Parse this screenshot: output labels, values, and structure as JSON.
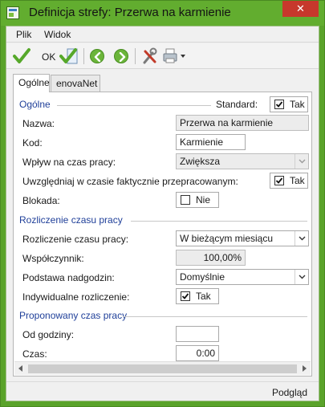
{
  "window": {
    "title": "Definicja strefy: Przerwa na karmienie",
    "close_glyph": "✕"
  },
  "menu": {
    "items": [
      {
        "label": "Plik"
      },
      {
        "label": "Widok"
      }
    ]
  },
  "toolbar": {
    "ok_label": "OK"
  },
  "tabs": [
    {
      "label": "Ogólne",
      "active": true
    },
    {
      "label": "enovaNet",
      "active": false
    }
  ],
  "sections": {
    "general": {
      "title": "Ogólne",
      "standard_label": "Standard:",
      "standard_value": "Tak",
      "standard_checked": true,
      "fields": {
        "nazwa": {
          "label": "Nazwa:",
          "value": "Przerwa na karmienie"
        },
        "kod": {
          "label": "Kod:",
          "value": "Karmienie"
        },
        "wplyw": {
          "label": "Wpływ na czas pracy:",
          "value": "Zwiększa"
        },
        "uwzgledniaj": {
          "label": "Uwzględniaj w czasie faktycznie przepracowanym:",
          "value": "Tak",
          "checked": true
        },
        "blokada": {
          "label": "Blokada:",
          "value": "Nie",
          "checked": false
        }
      }
    },
    "settlement": {
      "title": "Rozliczenie czasu pracy",
      "fields": {
        "rozliczenie": {
          "label": "Rozliczenie czasu pracy:",
          "value": "W bieżącym miesiącu"
        },
        "wspolczynnik": {
          "label": "Współczynnik:",
          "value": "100,00%"
        },
        "podstawa": {
          "label": "Podstawa nadgodzin:",
          "value": "Domyślnie"
        },
        "indywidualne": {
          "label": "Indywidualne rozliczenie:",
          "value": "Tak",
          "checked": true
        }
      }
    },
    "proposed": {
      "title": "Proponowany czas pracy",
      "fields": {
        "od_godziny": {
          "label": "Od godziny:",
          "value": ""
        },
        "czas": {
          "label": "Czas:",
          "value": "0:00"
        }
      }
    }
  },
  "status": {
    "text": "Podgląd"
  },
  "icons": {
    "app": "app-window-icon",
    "ok": "green-check-icon",
    "save_close": "check-document-icon",
    "back": "back-arrow-icon",
    "forward": "forward-arrow-icon",
    "tools": "tools-icon",
    "print": "printer-icon"
  },
  "colors": {
    "titlebar": "#62ad2f",
    "section_title": "#1f3f99",
    "close": "#c7382c"
  }
}
